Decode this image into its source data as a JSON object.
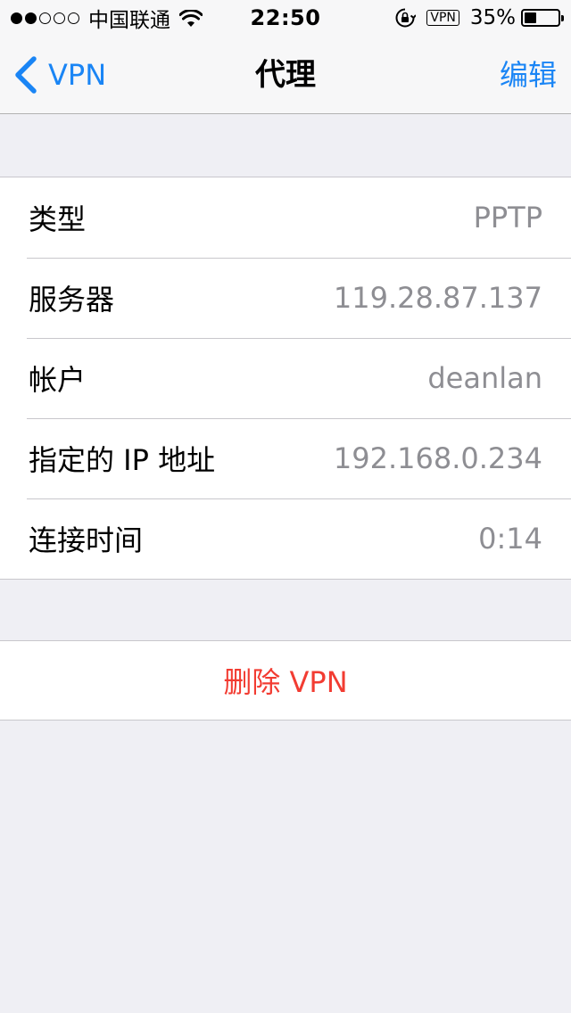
{
  "status": {
    "carrier": "中国联通",
    "time": "22:50",
    "vpn_badge": "VPN",
    "battery_percent": "35%",
    "battery_level": 0.35,
    "signal_bars_filled": 2,
    "signal_bars_total": 5
  },
  "nav": {
    "back_label": "VPN",
    "title": "代理",
    "edit_label": "编辑",
    "accent_color": "#1a85f5"
  },
  "details": [
    {
      "label": "类型",
      "value": "PPTP"
    },
    {
      "label": "服务器",
      "value": "119.28.87.137"
    },
    {
      "label": "帐户",
      "value": "deanlan"
    },
    {
      "label": "指定的 IP 地址",
      "value": "192.168.0.234"
    },
    {
      "label": "连接时间",
      "value": "0:14"
    }
  ],
  "actions": {
    "delete_label": "删除 VPN",
    "delete_color": "#f23c32"
  },
  "icons": {
    "back": "chevron-left-icon",
    "wifi": "wifi-icon",
    "rotation_lock": "rotation-lock-icon",
    "battery": "battery-icon"
  }
}
